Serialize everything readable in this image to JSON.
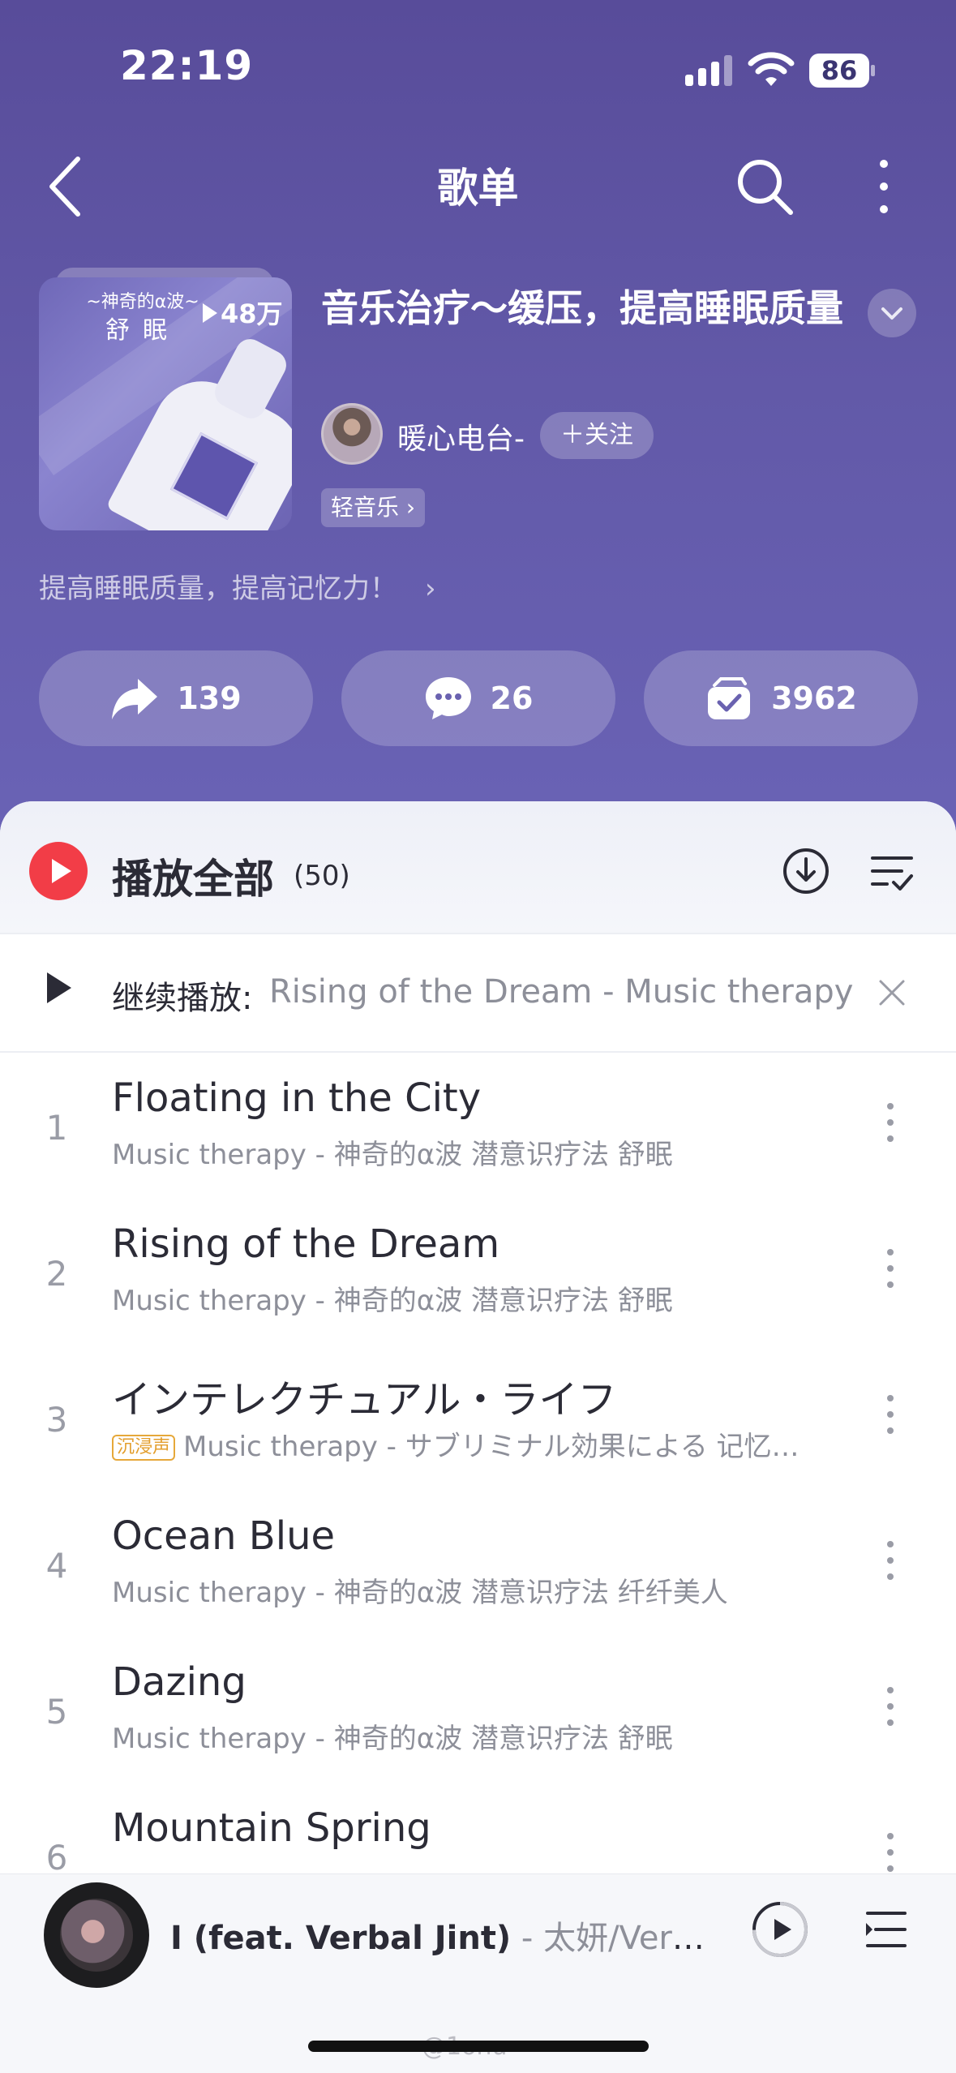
{
  "status_bar": {
    "time": "22:19",
    "battery": "86"
  },
  "nav": {
    "title": "歌单"
  },
  "playlist": {
    "cover_line1": "~神奇的α波~",
    "cover_line2": "舒眠",
    "play_count": "48万",
    "title": "音乐治疗～缓压，提高睡眠质量",
    "creator": "暖心电台-",
    "follow_label": "关注",
    "tag": "轻音乐",
    "description": "提高睡眠质量，提高记忆力！"
  },
  "actions": {
    "share_count": "139",
    "comment_count": "26",
    "collect_count": "3962"
  },
  "list_header": {
    "play_all_label": "播放全部",
    "count": "(50)"
  },
  "resume": {
    "label": "继续播放:",
    "track": "Rising of the Dream - Music therapy"
  },
  "tracks": [
    {
      "num": "1",
      "title": "Floating in the City",
      "subtitle": "Music therapy - 神奇的α波 潜意识疗法 舒眠",
      "badge": ""
    },
    {
      "num": "2",
      "title": "Rising of the Dream",
      "subtitle": "Music therapy - 神奇的α波 潜意识疗法 舒眠",
      "badge": ""
    },
    {
      "num": "3",
      "title": "インテレクチュアル・ライフ",
      "subtitle": "Music therapy - サブリミナル効果による 记忆…",
      "badge": "沉浸声"
    },
    {
      "num": "4",
      "title": "Ocean Blue",
      "subtitle": "Music therapy - 神奇的α波 潜意识疗法 纤纤美人",
      "badge": ""
    },
    {
      "num": "5",
      "title": "Dazing",
      "subtitle": "Music therapy - 神奇的α波 潜意识疗法 舒眠",
      "badge": ""
    },
    {
      "num": "6",
      "title": "Mountain Spring",
      "subtitle": "",
      "badge": ""
    }
  ],
  "mini_player": {
    "song": "I (feat. Verbal Jint)",
    "artist": " - 太妍/Verbal..."
  },
  "watermark": "@1onu",
  "colors": {
    "header": "#5e55a5",
    "accent": "#f23d47",
    "badge": "#e39e2c"
  }
}
